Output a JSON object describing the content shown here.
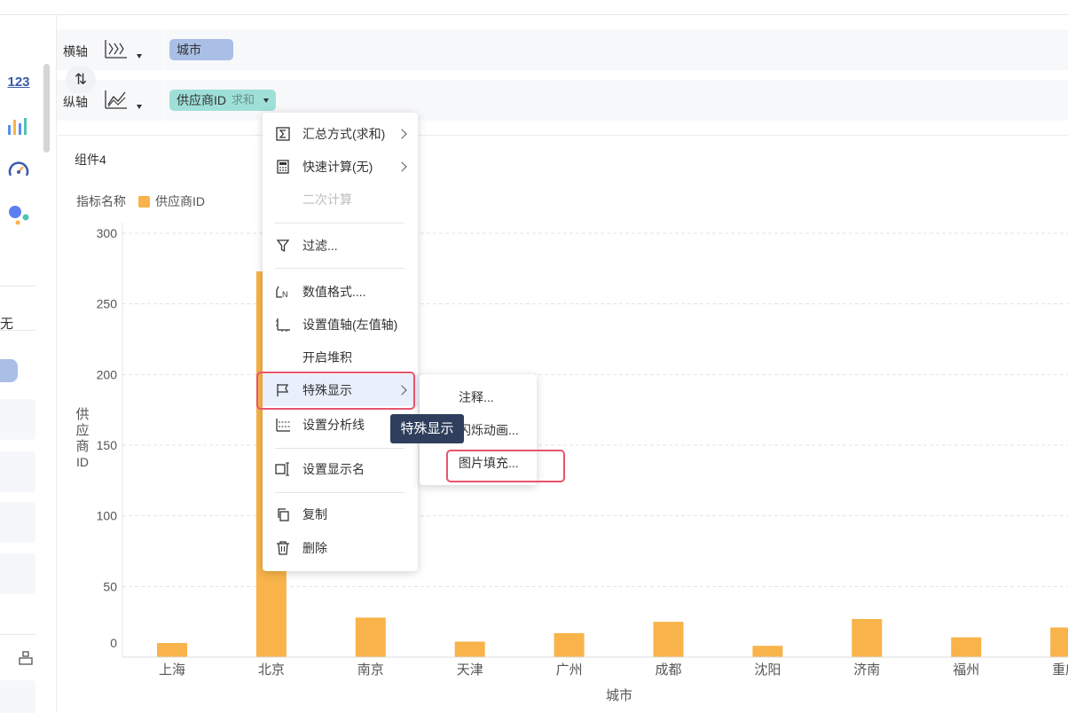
{
  "axes": {
    "x_label": "横轴",
    "y_label": "纵轴",
    "swap_glyph": "⇅",
    "x_field": "城市",
    "y_field": "供应商ID",
    "y_agg": "求和"
  },
  "sidebar": {
    "text_icon": "123",
    "partial_char": "无"
  },
  "panel": {
    "title": "组件4",
    "legend_label": "指标名称",
    "legend_series": "供应商ID"
  },
  "menu": {
    "items": [
      {
        "label": "汇总方式(求和)",
        "icon": "sigma-icon",
        "submenu": true
      },
      {
        "label": "快速计算(无)",
        "icon": "calculator-icon",
        "submenu": true
      },
      {
        "label": "二次计算",
        "icon": "",
        "disabled": true
      },
      {
        "label": "过滤...",
        "icon": "filter-icon"
      },
      {
        "label": "数值格式....",
        "icon": "number-format-icon"
      },
      {
        "label": "设置值轴(左值轴)",
        "icon": "value-axis-icon"
      },
      {
        "label": "开启堆积",
        "icon": ""
      },
      {
        "label": "特殊显示",
        "icon": "flag-icon",
        "submenu": true,
        "active": true
      },
      {
        "label": "设置分析线",
        "icon": "analysis-line-icon"
      },
      {
        "label": "设置显示名",
        "icon": "rename-icon"
      },
      {
        "label": "复制",
        "icon": "copy-icon"
      },
      {
        "label": "删除",
        "icon": "trash-icon"
      }
    ]
  },
  "submenu": {
    "items": [
      "注释...",
      "闪烁动画...",
      "图片填充..."
    ]
  },
  "tooltip": "特殊显示",
  "colors": {
    "bar": "#f8b34a",
    "highlight": "#e8546b",
    "tooltip_bg": "#2f3e5c"
  },
  "chart_data": {
    "type": "bar",
    "categories": [
      "上海",
      "北京",
      "南京",
      "天津",
      "广州",
      "成都",
      "沈阳",
      "济南",
      "福州",
      "重庆"
    ],
    "series": [
      {
        "name": "供应商ID",
        "values": [
          10,
          273,
          28,
          11,
          17,
          25,
          8,
          27,
          14,
          21
        ]
      }
    ],
    "xlabel": "城市",
    "ylabel": "供应商ID",
    "ylim": [
      0,
      300
    ],
    "yticks": [
      0,
      50,
      100,
      150,
      200,
      250,
      300
    ],
    "grid": true,
    "legend": "top-left"
  }
}
